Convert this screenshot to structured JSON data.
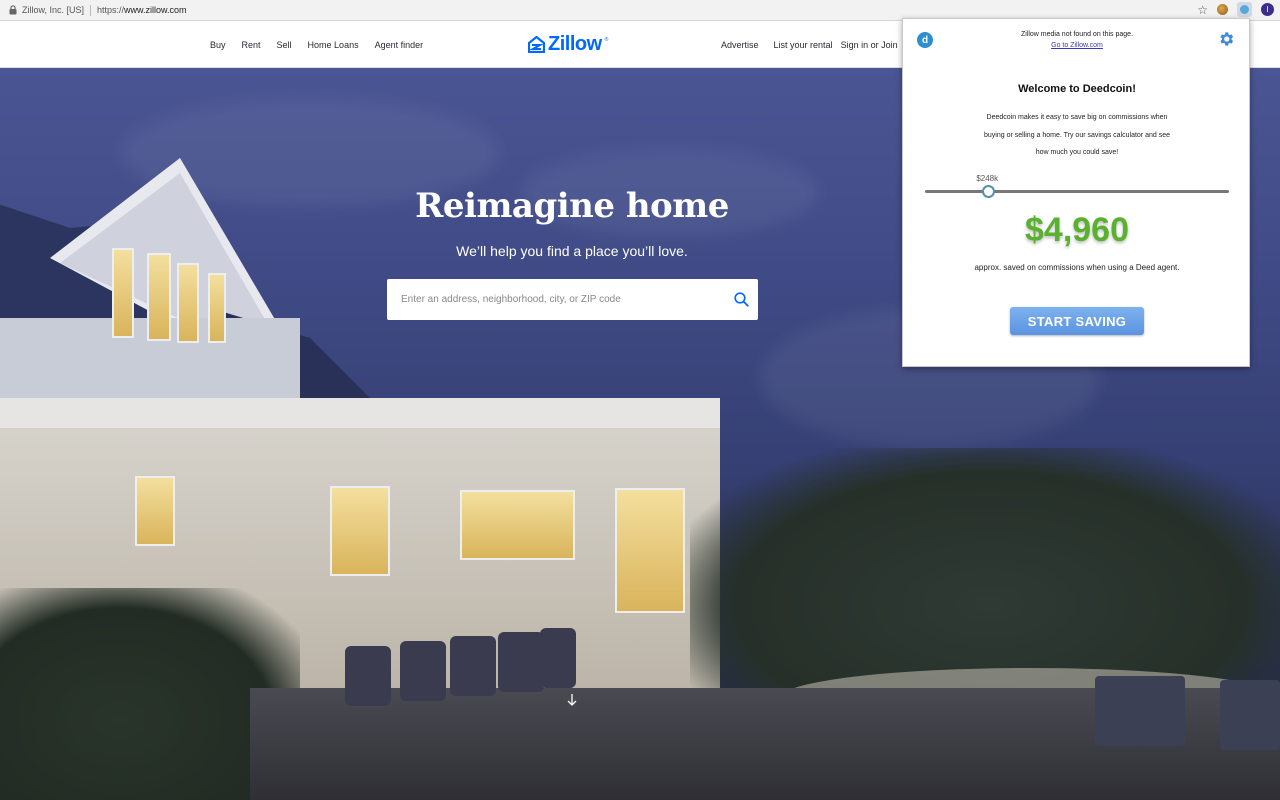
{
  "browser": {
    "site_identity": "Zillow, Inc. [US]",
    "url_scheme": "https://",
    "url_host": "www.zillow.com",
    "avatar_initial": "I"
  },
  "header": {
    "nav_left": [
      "Buy",
      "Rent",
      "Sell",
      "Home Loans",
      "Agent finder"
    ],
    "logo_text": "Zillow",
    "logo_mark": "®",
    "nav_right": [
      "Advertise",
      "List your rental"
    ],
    "signin": "Sign in",
    "or": "or",
    "join": "Join",
    "brand_color": "#006aff"
  },
  "hero": {
    "title": "Reimagine home",
    "subtitle": "We’ll help you find a place you’ll love.",
    "search_placeholder": "Enter an address, neighborhood, city, or ZIP code"
  },
  "popup": {
    "notice_line": "Zillow media not found on this page.",
    "notice_link": "Go to Zillow.com",
    "welcome": "Welcome to Deedcoin!",
    "description": "Deedcoin makes it easy to save big on commissions when buying or selling a home. Try our savings calculator and see how much you could save!",
    "slider_label": "$248k",
    "slider_fraction": 0.21,
    "savings_amount": "$4,960",
    "savings_caption": "approx. saved on commissions when using a Deed agent.",
    "cta_label": "START SAVING",
    "accent_green": "#5ab02f",
    "cta_color": "#5b93e0"
  }
}
